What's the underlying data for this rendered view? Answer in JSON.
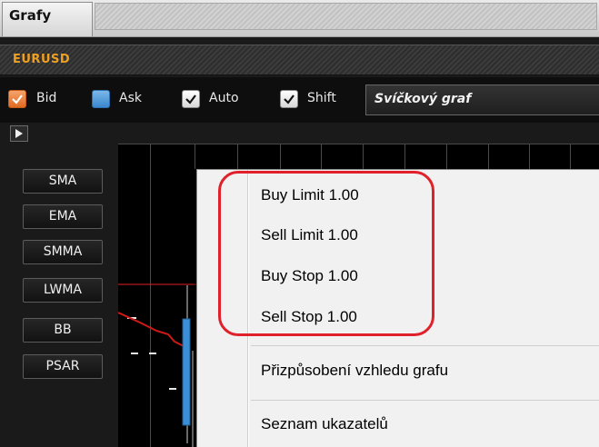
{
  "window": {
    "tab_title": "Grafy"
  },
  "symbol_bar": {
    "symbol": "EURUSD"
  },
  "toolbar": {
    "checkboxes": [
      {
        "label": "Bid",
        "checked": true,
        "color": "#e8782e"
      },
      {
        "label": "Ask",
        "checked": false,
        "color": "#4a92d6"
      },
      {
        "label": "Auto",
        "checked": true
      },
      {
        "label": "Shift",
        "checked": true
      }
    ],
    "chart_type": "Svíčkový graf"
  },
  "indicators": [
    "SMA",
    "EMA",
    "SMMA",
    "LWMA",
    "BB",
    "PSAR"
  ],
  "context_menu": {
    "orders": [
      "Buy Limit 1.00",
      "Sell Limit 1.00",
      "Buy Stop 1.00",
      "Sell Stop 1.00"
    ],
    "customize": "Přizpůsobení vzhledu grafu",
    "indicator_list": "Seznam ukazatelů"
  },
  "colors": {
    "symbol": "#f0a020",
    "highlight": "#e0202a",
    "price_line": "#e02020",
    "candle": "#3a8fd6"
  }
}
